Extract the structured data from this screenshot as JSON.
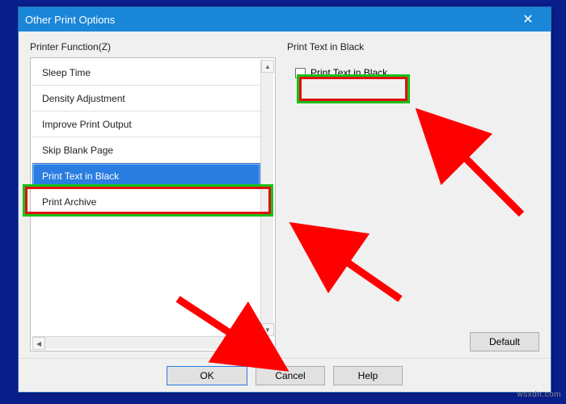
{
  "dialog": {
    "title": "Other Print Options",
    "close_glyph": "✕"
  },
  "left": {
    "label": "Printer Function(Z)",
    "items": [
      {
        "label": "Sleep Time",
        "selected": false
      },
      {
        "label": "Density Adjustment",
        "selected": false
      },
      {
        "label": "Improve Print Output",
        "selected": false
      },
      {
        "label": "Skip Blank Page",
        "selected": false
      },
      {
        "label": "Print Text in Black",
        "selected": true
      },
      {
        "label": "Print Archive",
        "selected": false
      }
    ]
  },
  "right": {
    "label": "Print Text in Black",
    "checkbox_label": "Print Text in Black",
    "checkbox_checked": false,
    "default_label": "Default"
  },
  "footer": {
    "ok": "OK",
    "cancel": "Cancel",
    "help": "Help"
  },
  "watermark": "wsxdn.com",
  "colors": {
    "accent": "#1a86d8",
    "selection": "#2a7de1",
    "highlight_outer": "#18c018",
    "highlight_inner": "#e01010",
    "arrow": "#ff0000"
  }
}
